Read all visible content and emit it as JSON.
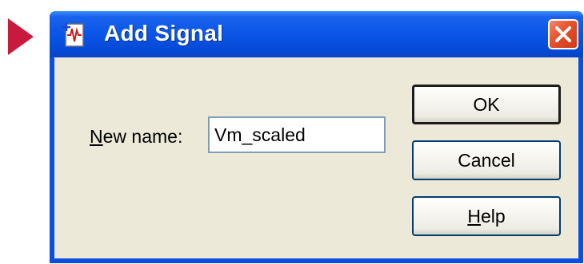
{
  "window": {
    "title": "Add Signal",
    "title_icon": "signal-document-icon",
    "close_icon": "close-icon"
  },
  "form": {
    "label_mnemonic": "N",
    "label_rest": "ew name:",
    "name_value": "Vm_scaled"
  },
  "buttons": {
    "ok_label": "OK",
    "cancel_label": "Cancel",
    "help_mnemonic": "H",
    "help_rest": "elp"
  },
  "colors": {
    "pointer_arrow": "#c8193f",
    "titlebar": "#0a55e6",
    "dialog_face": "#ece9d8",
    "close_button": "#e4512d"
  }
}
